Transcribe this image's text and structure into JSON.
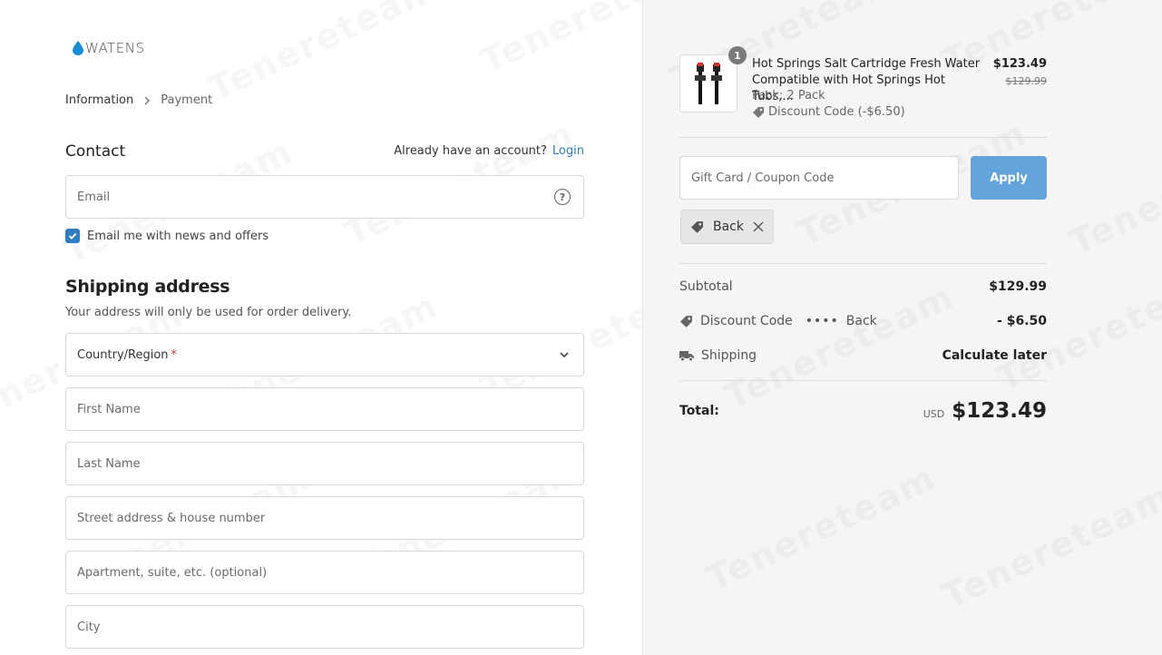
{
  "brand": {
    "logo_text": "WATENS",
    "drop_color": "#1b8fd6"
  },
  "breadcrumb": {
    "steps": [
      "Information",
      "Payment"
    ]
  },
  "contact": {
    "title": "Contact",
    "account_prompt": "Already have an account?",
    "login_label": "Login",
    "email_placeholder": "Email",
    "newsletter_label": "Email me with news and offers",
    "newsletter_checked": true
  },
  "shipping": {
    "title": "Shipping address",
    "subtitle": "Your address will only be used for order delivery.",
    "country_label": "Country/Region",
    "required_mark": "*",
    "first_name_placeholder": "First Name",
    "last_name_placeholder": "Last Name",
    "street_placeholder": "Street address & house number",
    "apartment_placeholder": "Apartment, suite, etc. (optional)",
    "city_placeholder": "City"
  },
  "cart": {
    "item": {
      "quantity": "1",
      "title": "Hot Springs Salt Cartridge Fresh Water Compatible with Hot Springs Hot Tubs,...",
      "variant": "Pack: 2 Pack",
      "discount": "Discount Code (-$6.50)",
      "price": "$123.49",
      "compare_price": "$129.99"
    },
    "coupon_placeholder": "Gift Card / Coupon Code",
    "apply_label": "Apply",
    "applied_code": "Back"
  },
  "summary": {
    "subtotal_label": "Subtotal",
    "subtotal_value": "$129.99",
    "discount_label": "Discount Code",
    "discount_dots": "••••",
    "discount_code": "Back",
    "discount_value": "- $6.50",
    "shipping_label": "Shipping",
    "shipping_value": "Calculate later",
    "total_label": "Total:",
    "currency": "USD",
    "total_value": "$123.49"
  },
  "colors": {
    "accent": "#2f7dc1",
    "apply_button": "#64a4dc",
    "required": "#e32c2b"
  }
}
